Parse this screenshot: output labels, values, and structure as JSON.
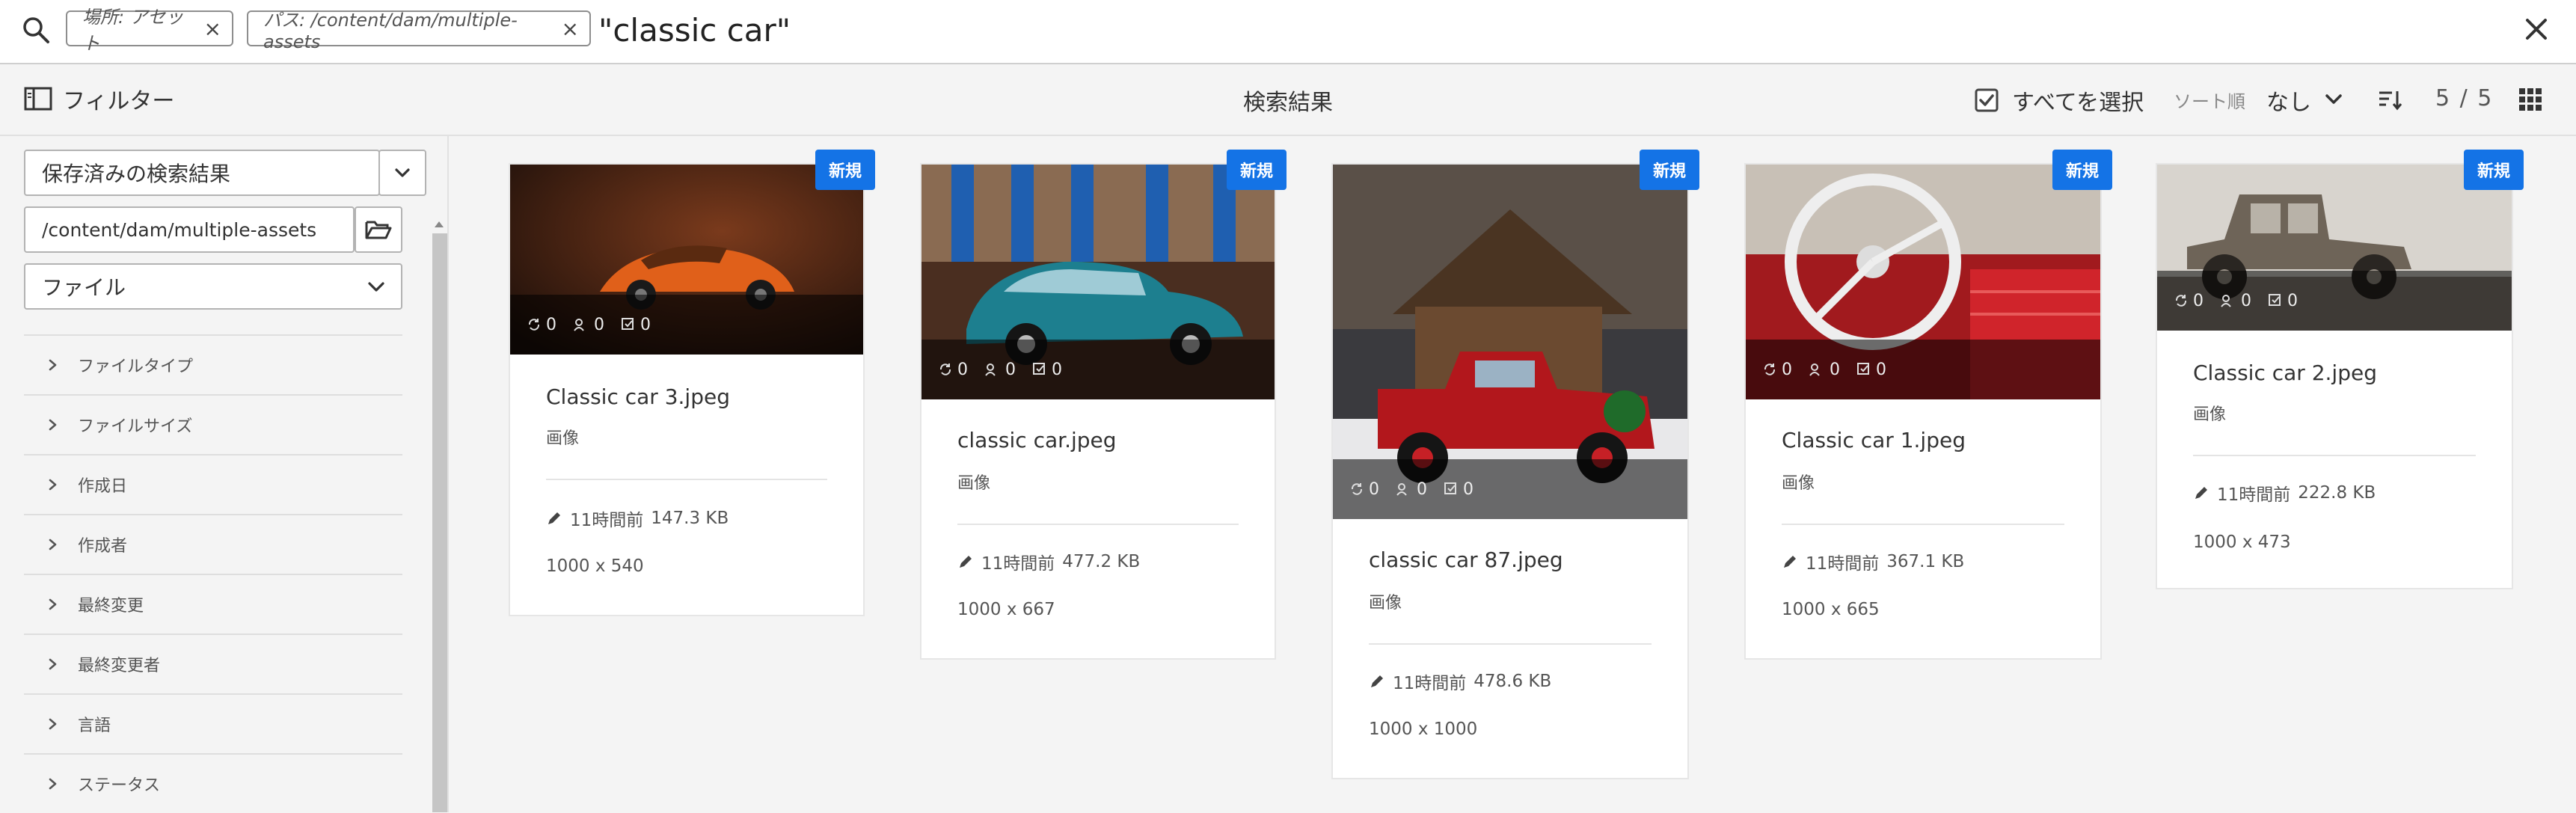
{
  "search": {
    "tags": [
      {
        "label": "場所: アセット"
      },
      {
        "label": "パス: /content/dam/multiple-assets"
      }
    ],
    "query": "\"classic car\""
  },
  "toolbar": {
    "filter_label": "フィルター",
    "results_title": "検索結果",
    "select_all_label": "すべてを選択",
    "sort_label": "ソート順",
    "sort_value": "なし",
    "count": "5 / 5"
  },
  "rail": {
    "saved_search": "保存済みの検索結果",
    "path_value": "/content/dam/multiple-assets",
    "type_select": "ファイル",
    "facets": [
      "ファイルタイプ",
      "ファイルサイズ",
      "作成日",
      "作成者",
      "最終変更",
      "最終変更者",
      "言語",
      "ステータス"
    ]
  },
  "cards": [
    {
      "badge": "新規",
      "title": "Classic car 3.jpeg",
      "type": "画像",
      "sync": "0",
      "comments": "0",
      "tasks": "0",
      "modified": "11時間前",
      "size": "147.3 KB",
      "dims": "1000 x 540",
      "thumb_scene": "orange-sports-car"
    },
    {
      "badge": "新規",
      "title": "classic car.jpeg",
      "type": "画像",
      "sync": "0",
      "comments": "0",
      "tasks": "0",
      "modified": "11時間前",
      "size": "477.2 KB",
      "dims": "1000 x 667",
      "thumb_scene": "blue-vintage-car"
    },
    {
      "badge": "新規",
      "title": "classic car 87.jpeg",
      "type": "画像",
      "sync": "0",
      "comments": "0",
      "tasks": "0",
      "modified": "11時間前",
      "size": "478.6 KB",
      "dims": "1000 x 1000",
      "thumb_scene": "red-christmas-truck"
    },
    {
      "badge": "新規",
      "title": "Classic car 1.jpeg",
      "type": "画像",
      "sync": "0",
      "comments": "0",
      "tasks": "0",
      "modified": "11時間前",
      "size": "367.1 KB",
      "dims": "1000 x 665",
      "thumb_scene": "red-car-interior"
    },
    {
      "badge": "新規",
      "title": "Classic car 2.jpeg",
      "type": "画像",
      "sync": "0",
      "comments": "0",
      "tasks": "0",
      "modified": "11時間前",
      "size": "222.8 KB",
      "dims": "1000 x 473",
      "thumb_scene": "sepia-antique-car"
    }
  ],
  "colors": {
    "accent": "#1473e6"
  }
}
